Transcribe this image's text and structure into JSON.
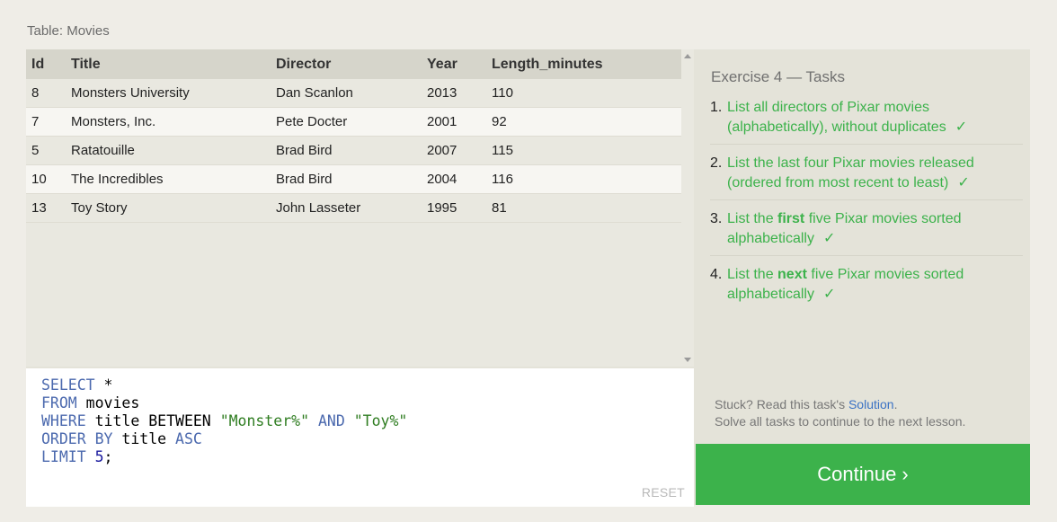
{
  "table_caption": "Table: Movies",
  "columns": [
    "Id",
    "Title",
    "Director",
    "Year",
    "Length_minutes"
  ],
  "rows": [
    [
      "8",
      "Monsters University",
      "Dan Scanlon",
      "2013",
      "110"
    ],
    [
      "7",
      "Monsters, Inc.",
      "Pete Docter",
      "2001",
      "92"
    ],
    [
      "5",
      "Ratatouille",
      "Brad Bird",
      "2007",
      "115"
    ],
    [
      "10",
      "The Incredibles",
      "Brad Bird",
      "2004",
      "116"
    ],
    [
      "13",
      "Toy Story",
      "John Lasseter",
      "1995",
      "81"
    ]
  ],
  "editor": {
    "code_lines": [
      [
        {
          "t": "SELECT",
          "c": "kw"
        },
        {
          "t": " *",
          "c": ""
        }
      ],
      [
        {
          "t": "FROM",
          "c": "kw"
        },
        {
          "t": " movies",
          "c": ""
        }
      ],
      [
        {
          "t": "WHERE",
          "c": "kw"
        },
        {
          "t": " title BETWEEN ",
          "c": ""
        },
        {
          "t": "\"Monster%\"",
          "c": "str"
        },
        {
          "t": " ",
          "c": ""
        },
        {
          "t": "AND",
          "c": "kw"
        },
        {
          "t": " ",
          "c": ""
        },
        {
          "t": "\"Toy%\"",
          "c": "str"
        }
      ],
      [
        {
          "t": "ORDER BY",
          "c": "kw"
        },
        {
          "t": " title ",
          "c": ""
        },
        {
          "t": "ASC",
          "c": "kw"
        }
      ],
      [
        {
          "t": "LIMIT",
          "c": "kw"
        },
        {
          "t": " ",
          "c": ""
        },
        {
          "t": "5",
          "c": "num"
        },
        {
          "t": ";",
          "c": ""
        }
      ]
    ],
    "reset_label": "RESET"
  },
  "tasks": {
    "title": "Exercise 4 — Tasks",
    "items": [
      {
        "num": "1.",
        "parts": [
          {
            "t": "List all directors of Pixar movies (alphabetically), without duplicates",
            "b": false
          }
        ],
        "check": "✓"
      },
      {
        "num": "2.",
        "parts": [
          {
            "t": "List the last four Pixar movies released (ordered from most recent to least)",
            "b": false
          }
        ],
        "check": "✓"
      },
      {
        "num": "3.",
        "parts": [
          {
            "t": "List the ",
            "b": false
          },
          {
            "t": "first",
            "b": true
          },
          {
            "t": " five Pixar movies sorted alphabetically",
            "b": false
          }
        ],
        "check": "✓"
      },
      {
        "num": "4.",
        "parts": [
          {
            "t": "List the ",
            "b": false
          },
          {
            "t": "next",
            "b": true
          },
          {
            "t": " five Pixar movies sorted alphabetically",
            "b": false
          }
        ],
        "check": "✓"
      }
    ],
    "stuck_prefix": "Stuck? Read this task's ",
    "solution_link": "Solution",
    "stuck_suffix": ".",
    "stuck_line2": "Solve all tasks to continue to the next lesson."
  },
  "continue_label": "Continue ›"
}
